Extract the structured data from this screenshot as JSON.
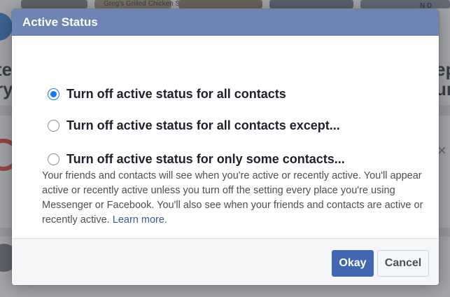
{
  "background": {
    "left_text_1": "te",
    "left_text_2": "ry",
    "right_text_1": "ep",
    "right_text_2": "ur",
    "right_top_text": "N D",
    "thumb_caption": "Greg's Grilled Chicken Salad",
    "close_glyph": "×"
  },
  "dialog": {
    "title": "Active Status",
    "options": [
      {
        "label": "Turn off active status for all contacts",
        "checked": true
      },
      {
        "label": "Turn off active status for all contacts except...",
        "checked": false
      },
      {
        "label": "Turn off active status for only some contacts...",
        "checked": false
      }
    ],
    "description": "Your friends and contacts will see when you're active or recently active. You'll appear active or recently active unless you turn off the setting every place you're using Messenger or Facebook. You'll also see when your friends and contacts are active or recently active.",
    "learn_more": "Learn more.",
    "buttons": {
      "okay": "Okay",
      "cancel": "Cancel"
    }
  },
  "colors": {
    "header_bg": "#6d84b4",
    "primary_button": "#4267b2",
    "link": "#365899",
    "radio_checked": "#1877f2"
  }
}
